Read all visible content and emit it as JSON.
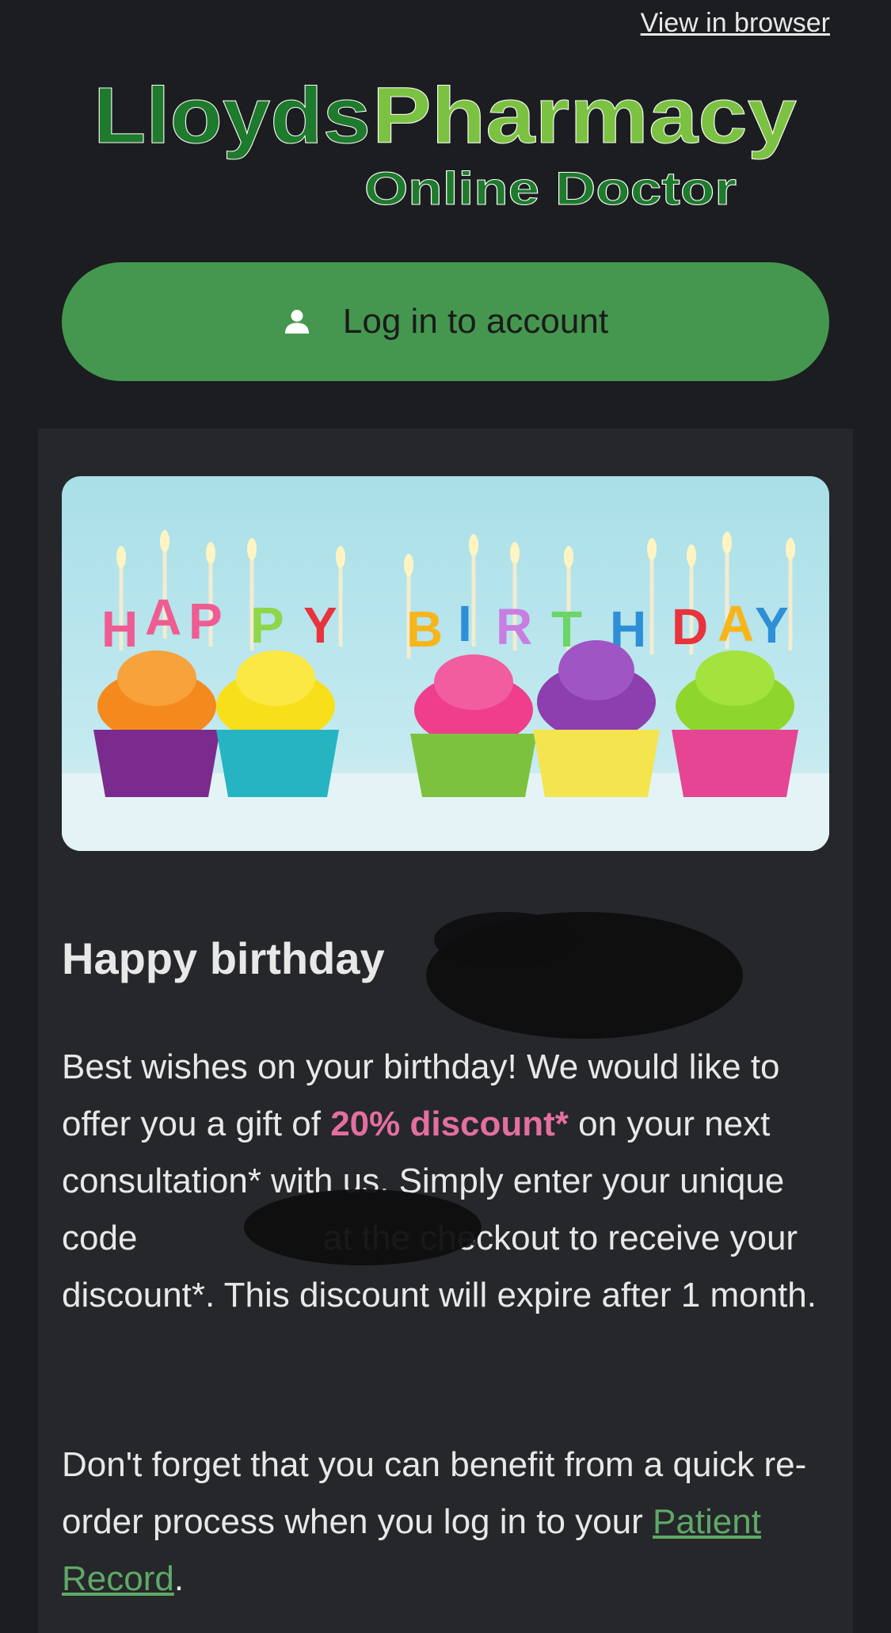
{
  "header": {
    "view_in_browser": "View in browser"
  },
  "logo": {
    "brand_primary": "Lloyds",
    "brand_secondary": "Pharmacy",
    "subtitle": "Online Doctor",
    "colors": {
      "dark_green": "#1e7a2c",
      "light_green": "#7cc242"
    }
  },
  "login": {
    "label": "Log in to account",
    "icon": "user-icon",
    "color": "#45974f"
  },
  "banner": {
    "letters": [
      "H",
      "A",
      "P",
      "P",
      "Y",
      "B",
      "I",
      "R",
      "T",
      "H",
      "D",
      "A",
      "Y"
    ]
  },
  "message": {
    "greeting": "Happy birthday",
    "p1_part1": "Best wishes on your birthday! We would like to offer you a gift of ",
    "p1_highlight": "20% discount*",
    "p1_part2": " on your next consultation* with us. Simply enter your unique code ",
    "p1_part3": " at the checkout to receive your discount*. This discount will expire after 1 month.",
    "p2_part1": "Don't forget that you can benefit from a quick re-order process when you log in to your ",
    "p2_link": "Patient Record",
    "p2_part2": "."
  }
}
